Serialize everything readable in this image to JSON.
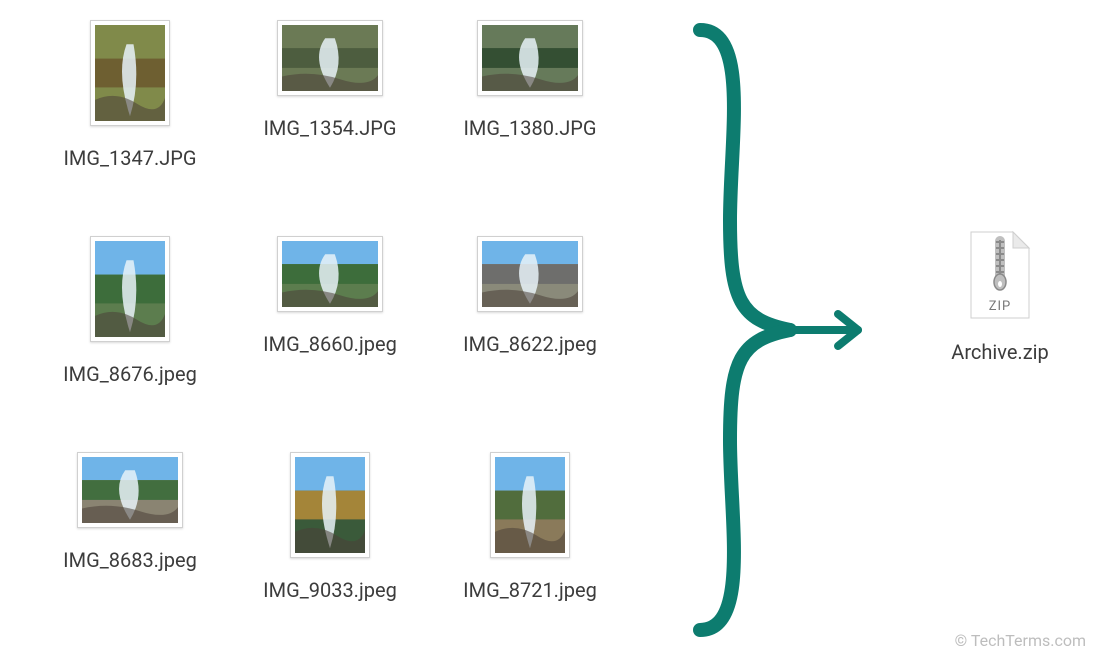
{
  "files": [
    {
      "name": "IMG_1347.JPG",
      "orientation": "portrait",
      "sky": false,
      "colorA": "#6b5a2f",
      "colorB": "#808a4a"
    },
    {
      "name": "IMG_1354.JPG",
      "orientation": "landscape",
      "sky": false,
      "colorA": "#4a5a3d",
      "colorB": "#6b7a55"
    },
    {
      "name": "IMG_1380.JPG",
      "orientation": "landscape",
      "sky": false,
      "colorA": "#2f4a2f",
      "colorB": "#667a5a"
    },
    {
      "name": "IMG_8676.jpeg",
      "orientation": "portrait",
      "sky": true,
      "colorA": "#3a6b3a",
      "colorB": "#5c7d4e"
    },
    {
      "name": "IMG_8660.jpeg",
      "orientation": "landscape",
      "sky": true,
      "colorA": "#3a6b3a",
      "colorB": "#5c7d4e"
    },
    {
      "name": "IMG_8622.jpeg",
      "orientation": "landscape",
      "sky": true,
      "colorA": "#6a6a6a",
      "colorB": "#8a8a7a"
    },
    {
      "name": "IMG_8683.jpeg",
      "orientation": "landscape",
      "sky": true,
      "colorA": "#3a6b3a",
      "colorB": "#8a8472"
    },
    {
      "name": "IMG_9033.jpeg",
      "orientation": "portrait",
      "sky": true,
      "colorA": "#b08a3a",
      "colorB": "#3a5a3a"
    },
    {
      "name": "IMG_8721.jpeg",
      "orientation": "portrait",
      "sky": true,
      "colorA": "#4a6b3a",
      "colorB": "#8a7a5a"
    }
  ],
  "archive": {
    "name": "Archive.zip",
    "ext_label": "ZIP"
  },
  "brace_color": "#0d7c6f",
  "watermark": "© TechTerms.com"
}
